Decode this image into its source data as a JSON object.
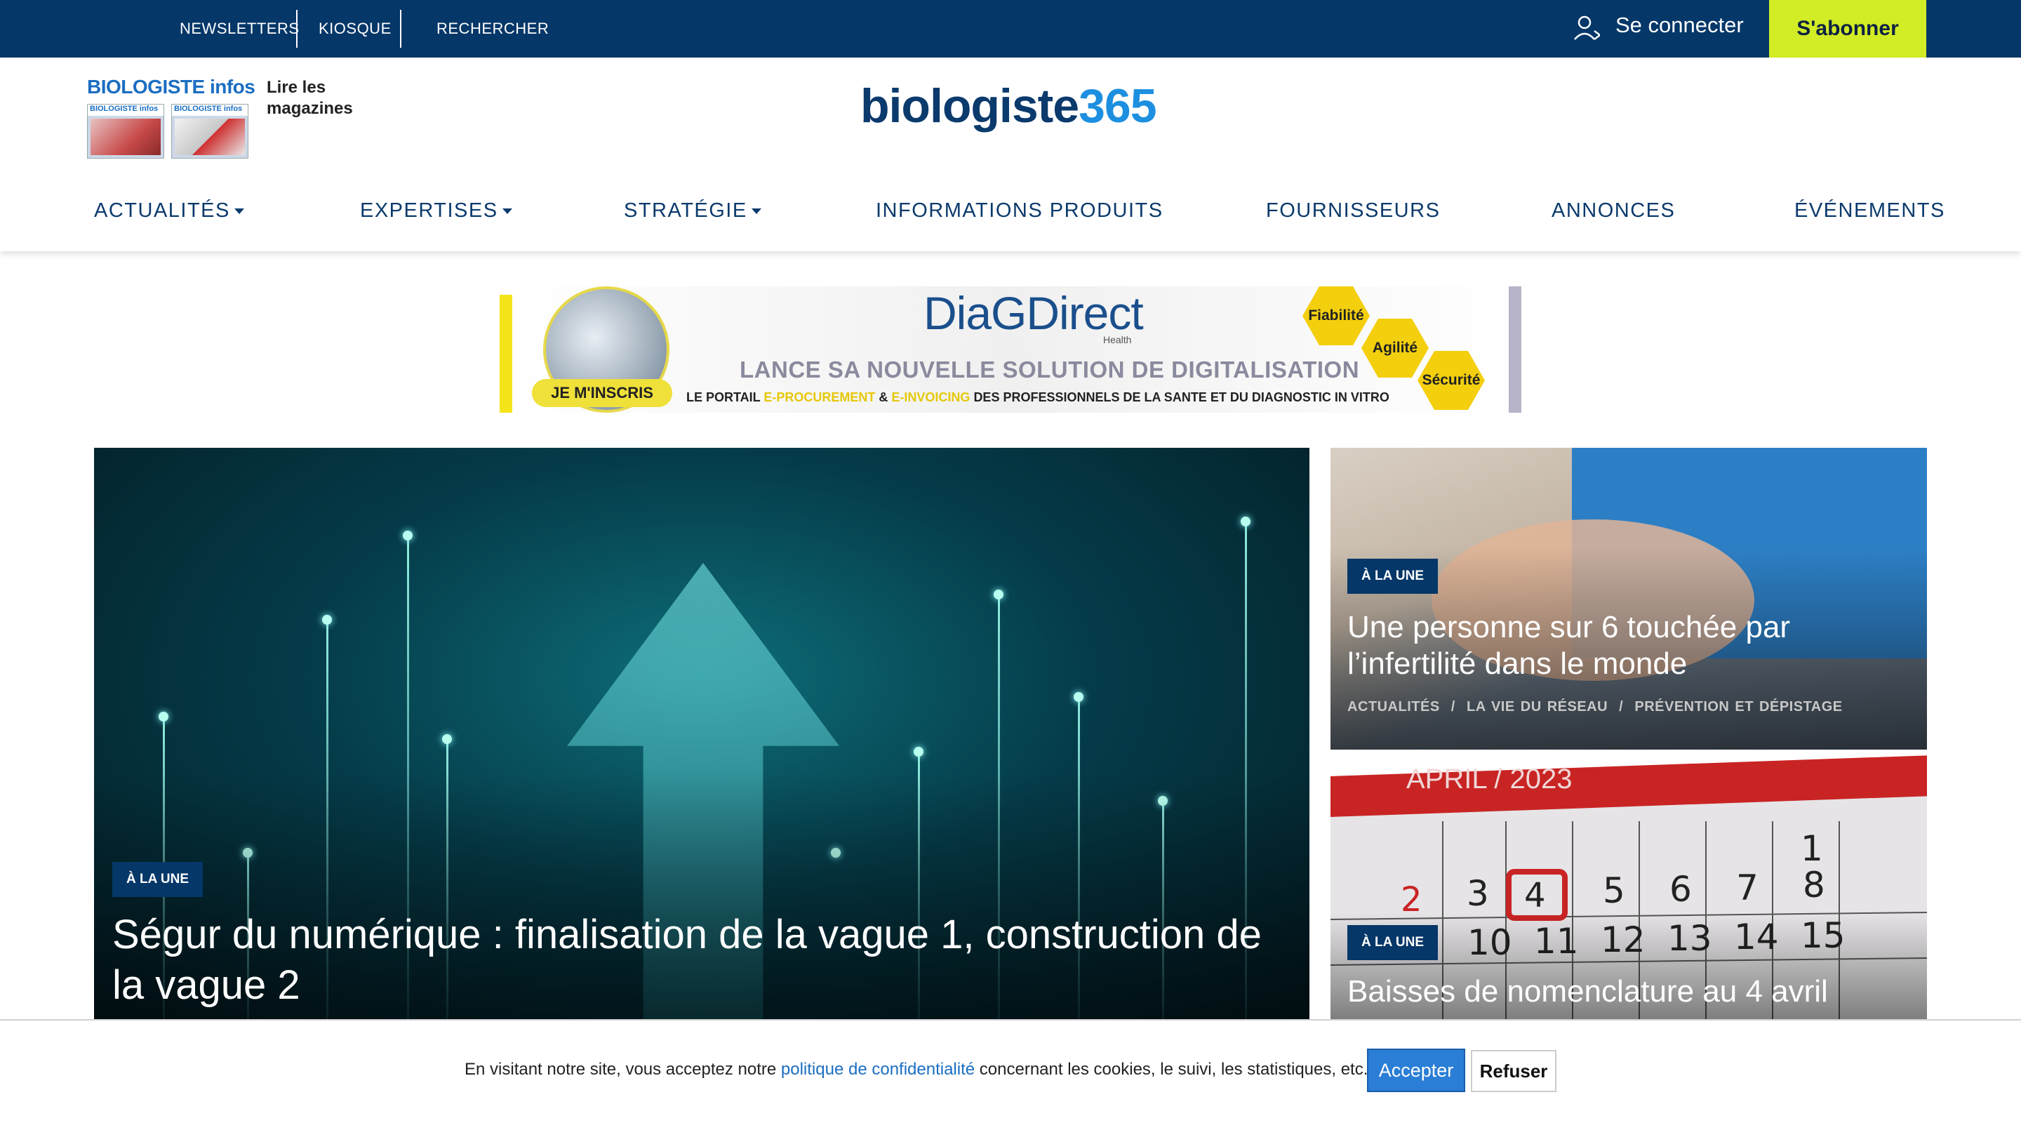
{
  "topbar": {
    "links": [
      "NEWSLETTERS",
      "KIOSQUE",
      "RECHERCHER"
    ],
    "login_label": "Se connecter",
    "subscribe_label": "S'abonner"
  },
  "header": {
    "magazine_title": "BIOLOGISTE infos",
    "magazine_cover_labels": [
      "BIOLOGISTE infos",
      "BIOLOGISTE infos"
    ],
    "magazine_link": "Lire les magazines",
    "logo_text": "biologiste",
    "logo_number": "365"
  },
  "nav": {
    "items": [
      {
        "label": "ACTUALITÉS",
        "dropdown": true
      },
      {
        "label": "EXPERTISES",
        "dropdown": true
      },
      {
        "label": "STRATÉGIE",
        "dropdown": true
      },
      {
        "label": "INFORMATIONS PRODUITS",
        "dropdown": false
      },
      {
        "label": "FOURNISSEURS",
        "dropdown": false
      },
      {
        "label": "ANNONCES",
        "dropdown": false
      },
      {
        "label": "ÉVÉNEMENTS",
        "dropdown": false
      }
    ]
  },
  "ad": {
    "brand": "DiaGDirect",
    "brand_sub": "Health",
    "headline": "LANCE SA NOUVELLE SOLUTION DE DIGITALISATION",
    "cta": "JE M'INSCRIS",
    "subline_pre": "LE PORTAIL",
    "subline_hl1": "E-PROCUREMENT",
    "subline_amp": "&",
    "subline_hl2": "E-INVOICING",
    "subline_post": "DES PROFESSIONNELS DE LA SANTE ET DU DIAGNOSTIC IN VITRO",
    "values": [
      "Fiabilité",
      "Agilité",
      "Sécurité"
    ]
  },
  "articles": {
    "main": {
      "badge": "À LA UNE",
      "title": "Ségur du numérique : finalisation de la vague 1, construction de la vague 2"
    },
    "side1": {
      "badge": "À LA UNE",
      "title": "Une personne sur 6 touchée par l’infertilité dans le monde",
      "tags": [
        "ACTUALITÉS",
        "LA VIE DU RÉSEAU",
        "PRÉVENTION ET DÉPISTAGE"
      ],
      "tag_sep": "/"
    },
    "side2": {
      "badge": "À LA UNE",
      "title": "Baisses de nomenclature au 4 avril",
      "calendar_month": "APRIL / 2023"
    }
  },
  "cookie": {
    "text_pre": "En visitant notre site, vous acceptez notre",
    "link": "politique de confidentialité",
    "text_post": "concernant les cookies, le suivi, les statistiques, etc.",
    "accept_label": "Accepter",
    "refuse_label": "Refuser"
  },
  "colors": {
    "brand_navy": "#053768",
    "subscribe_lime": "#d2ec25",
    "link_blue": "#1b6ec2",
    "logo_blue": "#1d8fe0"
  }
}
